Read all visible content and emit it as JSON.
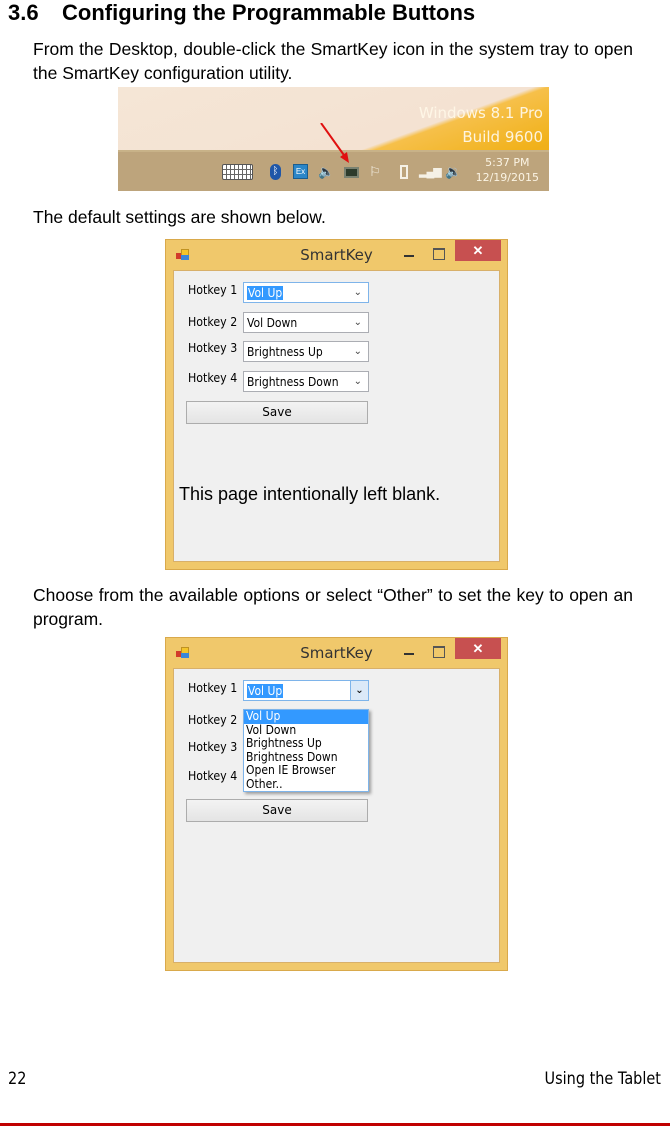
{
  "section": {
    "number": "3.6",
    "title": "Configuring the Programmable Buttons"
  },
  "paragraphs": {
    "intro": "From the Desktop, double-click the SmartKey icon in the system tray to open the SmartKey configuration utility.",
    "defaults": "The default settings are shown below.",
    "choose": "Choose from the available options or select “Other” to set the key to open an program."
  },
  "taskbar_screenshot": {
    "watermark_line1": "Windows 8.1 Pro",
    "watermark_line2": "Build 9600",
    "clock_time": "5:37 PM",
    "clock_date": "12/19/2015",
    "tray_icons": [
      "keyboard-icon",
      "bluetooth-icon",
      "exchange-icon",
      "speaker-icon",
      "smartkey-icon",
      "action-center-flag-icon",
      "battery-icon",
      "signal-icon",
      "volume-icon"
    ],
    "arrow_color": "#e01010"
  },
  "window_default": {
    "title": "SmartKey",
    "close_glyph": "✕",
    "hotkeys": [
      {
        "label": "Hotkey 1",
        "value": "Vol Up"
      },
      {
        "label": "Hotkey 2",
        "value": "Vol Down"
      },
      {
        "label": "Hotkey 3",
        "value": "Brightness Up"
      },
      {
        "label": "Hotkey 4",
        "value": "Brightness Down"
      }
    ],
    "save_label": "Save",
    "overlay_note": "This page intentionally left blank."
  },
  "window_dropdown": {
    "title": "SmartKey",
    "close_glyph": "✕",
    "hotkeys": [
      {
        "label": "Hotkey 1",
        "value": "Vol Up"
      },
      {
        "label": "Hotkey 2"
      },
      {
        "label": "Hotkey 3"
      },
      {
        "label": "Hotkey 4"
      }
    ],
    "dropdown_options": [
      "Vol Up",
      "Vol Down",
      "Brightness Up",
      "Brightness Down",
      "Open IE Browser",
      "Other.."
    ],
    "highlighted_option": "Vol Up",
    "save_label": "Save"
  },
  "footer": {
    "page_number": "22",
    "chapter": "Using the Tablet",
    "rule_color": "#c00000"
  },
  "colors": {
    "window_frame": "#f0c86b",
    "close_button": "#c75050",
    "selection": "#3399ff"
  }
}
